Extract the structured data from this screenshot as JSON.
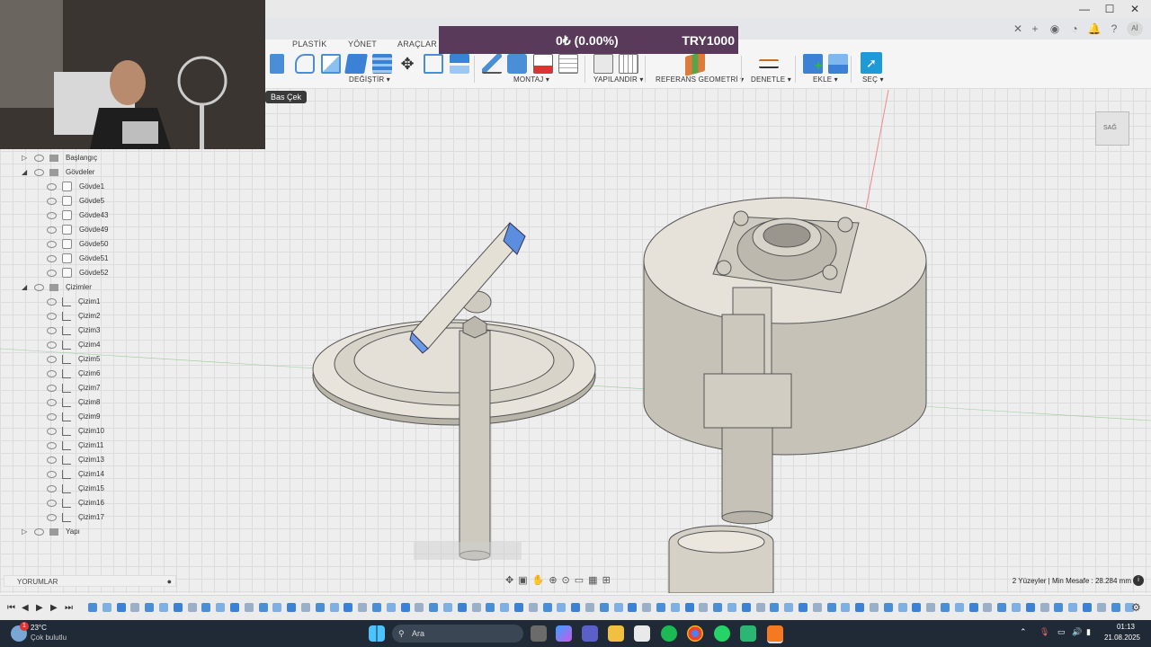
{
  "toolbar": {
    "tabs": [
      "PLASTİK",
      "YÖNET",
      "ARAÇLAR"
    ],
    "groups": [
      "DEĞİŞTİR ▾",
      "MONTAJ ▾",
      "YAPILANDIR ▾",
      "REFERANS GEOMETRİ ▾",
      "DENETLE ▾",
      "EKLE ▾",
      "SEÇ ▾"
    ],
    "tooltip": "Bas Çek"
  },
  "overlay": {
    "percent": "0₺ (0.00%)",
    "amount": "TRY1000"
  },
  "user_initials": "Aİ",
  "browser": {
    "items": [
      {
        "label": "Başlangıç",
        "kind": "folder",
        "expander": "▷"
      },
      {
        "label": "Gövdeler",
        "kind": "folder",
        "expander": "◢"
      },
      {
        "label": "Gövde1",
        "kind": "body"
      },
      {
        "label": "Gövde5",
        "kind": "body"
      },
      {
        "label": "Gövde43",
        "kind": "body"
      },
      {
        "label": "Gövde49",
        "kind": "body"
      },
      {
        "label": "Gövde50",
        "kind": "body"
      },
      {
        "label": "Gövde51",
        "kind": "body"
      },
      {
        "label": "Gövde52",
        "kind": "body"
      },
      {
        "label": "Çizimler",
        "kind": "folder",
        "expander": "◢"
      },
      {
        "label": "Çizim1",
        "kind": "sketch"
      },
      {
        "label": "Çizim2",
        "kind": "sketch"
      },
      {
        "label": "Çizim3",
        "kind": "sketch"
      },
      {
        "label": "Çizim4",
        "kind": "sketch"
      },
      {
        "label": "Çizim5",
        "kind": "sketch"
      },
      {
        "label": "Çizim6",
        "kind": "sketch"
      },
      {
        "label": "Çizim7",
        "kind": "sketch"
      },
      {
        "label": "Çizim8",
        "kind": "sketch"
      },
      {
        "label": "Çizim9",
        "kind": "sketch"
      },
      {
        "label": "Çizim10",
        "kind": "sketch"
      },
      {
        "label": "Çizim11",
        "kind": "sketch"
      },
      {
        "label": "Çizim13",
        "kind": "sketch"
      },
      {
        "label": "Çizim14",
        "kind": "sketch"
      },
      {
        "label": "Çizim15",
        "kind": "sketch"
      },
      {
        "label": "Çizim16",
        "kind": "sketch"
      },
      {
        "label": "Çizim17",
        "kind": "sketch"
      },
      {
        "label": "Yapı",
        "kind": "folder",
        "expander": "▷"
      }
    ]
  },
  "viewcube_label": "SAĞ",
  "comments_label": "YORUMLAR",
  "status_text": "2 Yüzeyler | Min Mesafe : 28.284 mm",
  "taskbar": {
    "weather_temp": "23°C",
    "weather_desc": "Çok bulutlu",
    "search_placeholder": "Ara",
    "time": "01:13",
    "date": "21.08.2025",
    "notification_badge": "1"
  }
}
